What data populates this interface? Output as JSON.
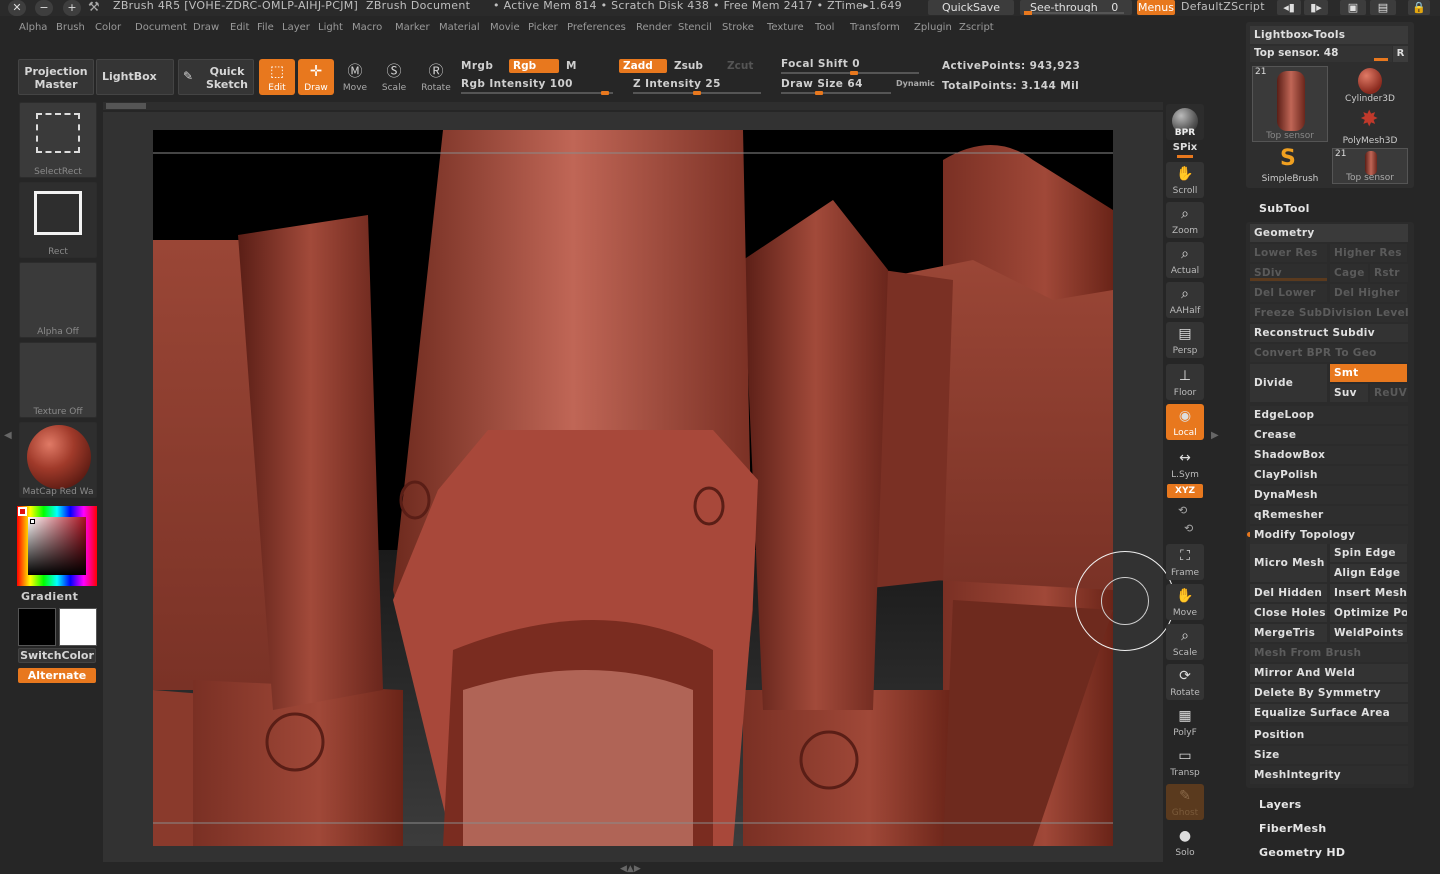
{
  "titlebar": {
    "app": "ZBrush 4R5 [VOHE-ZDRC-OMLP-AIHJ-PCJM]",
    "document": "ZBrush Document",
    "stats": "• Active Mem 814 • Scratch Disk 438 • Free Mem 2417 • ZTime▸1.649",
    "quicksave": "QuickSave",
    "seethrough_label": "See-through",
    "seethrough_value": "0",
    "menus": "Menus",
    "script": "DefaultZScript"
  },
  "menubar": [
    "Alpha",
    "Brush",
    "Color",
    "Document",
    "Draw",
    "Edit",
    "File",
    "Layer",
    "Light",
    "Macro",
    "Marker",
    "Material",
    "Movie",
    "Picker",
    "Preferences",
    "Render",
    "Stencil",
    "Stroke",
    "Texture",
    "Tool",
    "Transform",
    "Zplugin",
    "Zscript"
  ],
  "toolbar": {
    "projection_master": "Projection Master",
    "lightbox": "LightBox",
    "quick_sketch": "Quick Sketch",
    "edit": "Edit",
    "draw": "Draw",
    "move": "Move",
    "scale": "Scale",
    "rotate": "Rotate",
    "mrgb": "Mrgb",
    "rgb": "Rgb",
    "m": "M",
    "zadd": "Zadd",
    "zsub": "Zsub",
    "zcut": "Zcut",
    "rgb_intensity": "Rgb Intensity 100",
    "rgb_intensity_value": 100,
    "z_intensity": "Z Intensity 25",
    "z_intensity_value": 25,
    "focal_shift": "Focal Shift 0",
    "focal_shift_value": 0,
    "draw_size": "Draw Size 64",
    "draw_size_value": 64,
    "dynamic": "Dynamic",
    "active_points": "ActivePoints: 943,923",
    "total_points": "TotalPoints: 3.144 Mil"
  },
  "leftshelf": {
    "select_rect": "SelectRect",
    "rect": "Rect",
    "alpha": "Alpha Off",
    "texture": "Texture Off",
    "matcap": "MatCap Red Wa",
    "gradient": "Gradient",
    "switch_color": "SwitchColor",
    "alternate": "Alternate"
  },
  "rightshelf": {
    "bpr": "BPR",
    "spix": "SPix",
    "scroll": "Scroll",
    "zoom": "Zoom",
    "actual": "Actual",
    "aahalf": "AAHalf",
    "persp": "Persp",
    "floor": "Floor",
    "local": "Local",
    "lsym": "L.Sym",
    "xyz": "XYZ",
    "frame": "Frame",
    "move": "Move",
    "scale": "Scale",
    "rotate": "Rotate",
    "polyf": "PolyF",
    "transp": "Transp",
    "ghost": "Ghost",
    "solo": "Solo"
  },
  "tray": {
    "lightbox_tools": "Lightbox▸Tools",
    "top_sensor": "Top sensor. 48",
    "r": "R",
    "thumb_num": "21",
    "top_sensor_thumb": "Top sensor",
    "cylinder": "Cylinder3D",
    "polymesh": "PolyMesh3D",
    "simplebrush": "SimpleBrush",
    "top_sensor_thumb2": "Top sensor",
    "subtool": "SubTool",
    "geometry": "Geometry",
    "lower_res": "Lower Res",
    "higher_res": "Higher Res",
    "sdiv": "SDiv",
    "cage": "Cage",
    "rstr": "Rstr",
    "del_lower": "Del Lower",
    "del_higher": "Del Higher",
    "freeze": "Freeze SubDivision Levels",
    "reconstruct": "Reconstruct Subdiv",
    "convert_bpr": "Convert BPR To Geo",
    "divide": "Divide",
    "smt": "Smt",
    "suv": "Suv",
    "reuv": "ReUV",
    "edgeloop": "EdgeLoop",
    "crease": "Crease",
    "shadowbox": "ShadowBox",
    "claypolish": "ClayPolish",
    "dynamesh": "DynaMesh",
    "qremesher": "qRemesher",
    "modify_topology": "Modify Topology",
    "micro_mesh": "Micro Mesh",
    "spin_edge": "Spin Edge",
    "align_edge": "Align Edge",
    "del_hidden": "Del Hidden",
    "insert_mesh": "Insert Mesh",
    "close_holes": "Close Holes",
    "optimize_poi": "Optimize Poi",
    "mergetris": "MergeTris",
    "weldpoints": "WeldPoints",
    "mesh_from_brush": "Mesh From Brush",
    "mirror_weld": "Mirror And Weld",
    "delete_symmetry": "Delete By Symmetry",
    "equalize": "Equalize Surface Area",
    "position": "Position",
    "size": "Size",
    "meshintegrity": "MeshIntegrity",
    "layers": "Layers",
    "fibermesh": "FiberMesh",
    "geometry_hd": "Geometry HD"
  },
  "colors": {
    "accent": "#e8781e",
    "bg": "#262626",
    "panel": "#333333",
    "model": "#8e3b2e"
  }
}
